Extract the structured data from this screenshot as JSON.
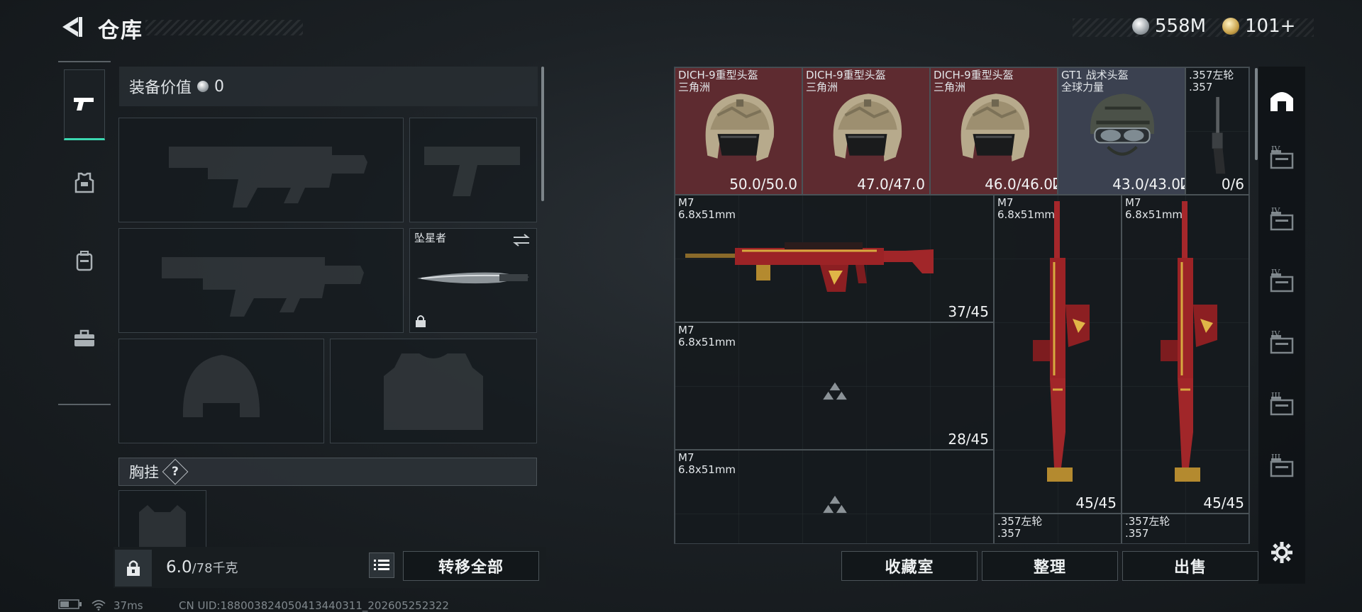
{
  "header": {
    "title": "仓库",
    "currency_silver": "558M",
    "currency_gold": "101+"
  },
  "left_rail": {
    "items": [
      {
        "name": "weapons-tab",
        "icon": "pistol-icon",
        "active": true
      },
      {
        "name": "armor-tab",
        "icon": "armor-vest-icon",
        "active": false
      },
      {
        "name": "backpack-tab",
        "icon": "backpack-icon",
        "active": false
      },
      {
        "name": "toolbox-tab",
        "icon": "toolbox-icon",
        "active": false
      }
    ]
  },
  "equipment": {
    "value_label": "装备价值",
    "value": "0",
    "melee_name": "坠星者",
    "chest_rig_label": "胸挂",
    "help_symbol": "?"
  },
  "footer_left": {
    "weight_current": "6.0",
    "weight_max": "/78千克",
    "transfer_all_label": "转移全部"
  },
  "inventory": {
    "items": [
      {
        "name": "DICH-9重型头盔",
        "sub": "三角洲",
        "value": "50.0/50.0",
        "bg": "red",
        "kind": "helmet-tan"
      },
      {
        "name": "DICH-9重型头盔",
        "sub": "三角洲",
        "value": "47.0/47.0",
        "bg": "red",
        "kind": "helmet-tan"
      },
      {
        "name": "DICH-9重型头盔",
        "sub": "三角洲",
        "value": "46.0/46.0",
        "bg": "red",
        "kind": "helmet-tan"
      },
      {
        "name": "GT1 战术头盔",
        "sub": "全球力量",
        "value": "43.0/43.0",
        "bg": "blue",
        "kind": "helmet-green"
      },
      {
        "name": ".357左轮",
        "sub": ".357",
        "value": "0/6",
        "bg": "dark",
        "kind": "revolver"
      },
      {
        "name": "M7",
        "sub": "6.8x51mm",
        "value": "37/45",
        "bg": "dark",
        "kind": "rifle-h"
      },
      {
        "name": "M7",
        "sub": "6.8x51mm",
        "value": "45/45",
        "bg": "dark",
        "kind": "rifle-v"
      },
      {
        "name": "M7",
        "sub": "6.8x51mm",
        "value": "45/45",
        "bg": "dark",
        "kind": "rifle-v"
      },
      {
        "name": "M7",
        "sub": "6.8x51mm",
        "value": "28/45",
        "bg": "dark",
        "kind": "placeholder"
      },
      {
        "name": "M7",
        "sub": "6.8x51mm",
        "value": "",
        "bg": "dark",
        "kind": "placeholder"
      },
      {
        "name": ".357左轮",
        "sub": ".357",
        "value": "",
        "bg": "dark",
        "kind": "revolver-small"
      },
      {
        "name": ".357左轮",
        "sub": ".357",
        "value": "",
        "bg": "dark",
        "kind": "revolver-small"
      }
    ]
  },
  "footer_right": {
    "collection_label": "收藏室",
    "sort_label": "整理",
    "sell_label": "出售"
  },
  "right_rail": {
    "tiers": [
      "IV",
      "IV",
      "IV",
      "IV",
      "III",
      "III"
    ]
  },
  "status_bar": {
    "ping": "37ms",
    "uid": "CN UID:188003824050413440311_202605252322"
  },
  "colors": {
    "accent": "#3bd7b0",
    "rare_red": "#5e2b30",
    "epic_blue": "#3b4150"
  }
}
